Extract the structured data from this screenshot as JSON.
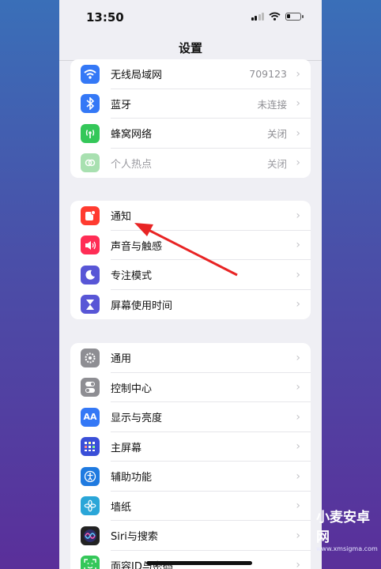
{
  "status": {
    "time": "13:50"
  },
  "nav": {
    "title": "设置"
  },
  "groups": [
    [
      {
        "label": "无线局域网",
        "value": "709123",
        "icon": "wifi-icon",
        "color": "#3478f6"
      },
      {
        "label": "蓝牙",
        "value": "未连接",
        "icon": "bluetooth-icon",
        "color": "#3478f6"
      },
      {
        "label": "蜂窝网络",
        "value": "关闭",
        "icon": "cellular-icon",
        "color": "#34c759"
      },
      {
        "label": "个人热点",
        "value": "关闭",
        "icon": "hotspot-icon",
        "color": "#a8e0b0",
        "dimmed": true
      }
    ],
    [
      {
        "label": "通知",
        "icon": "notification-icon",
        "color": "#ff3b30"
      },
      {
        "label": "声音与触感",
        "icon": "sound-icon",
        "color": "#ff2d55"
      },
      {
        "label": "专注模式",
        "icon": "moon-icon",
        "color": "#5856d6"
      },
      {
        "label": "屏幕使用时间",
        "icon": "hourglass-icon",
        "color": "#5856d6"
      }
    ],
    [
      {
        "label": "通用",
        "icon": "gear-icon",
        "color": "#8e8e93"
      },
      {
        "label": "控制中心",
        "icon": "toggle-icon",
        "color": "#8e8e93"
      },
      {
        "label": "显示与亮度",
        "icon": "text-size-icon",
        "color": "#3478f6"
      },
      {
        "label": "主屏幕",
        "icon": "grid-icon",
        "color": "#3a4fd8"
      },
      {
        "label": "辅助功能",
        "icon": "accessibility-icon",
        "color": "#1f7ae0"
      },
      {
        "label": "墙纸",
        "icon": "flower-icon",
        "color": "#2aa6d8"
      },
      {
        "label": "Siri与搜索",
        "icon": "siri-icon",
        "color": "#222222"
      },
      {
        "label": "面容ID与密码",
        "icon": "faceid-icon",
        "color": "#34c759"
      }
    ]
  ],
  "watermark": {
    "title": "小麦安卓网",
    "url": "www.xmsigma.com"
  },
  "accent": "#e82424"
}
